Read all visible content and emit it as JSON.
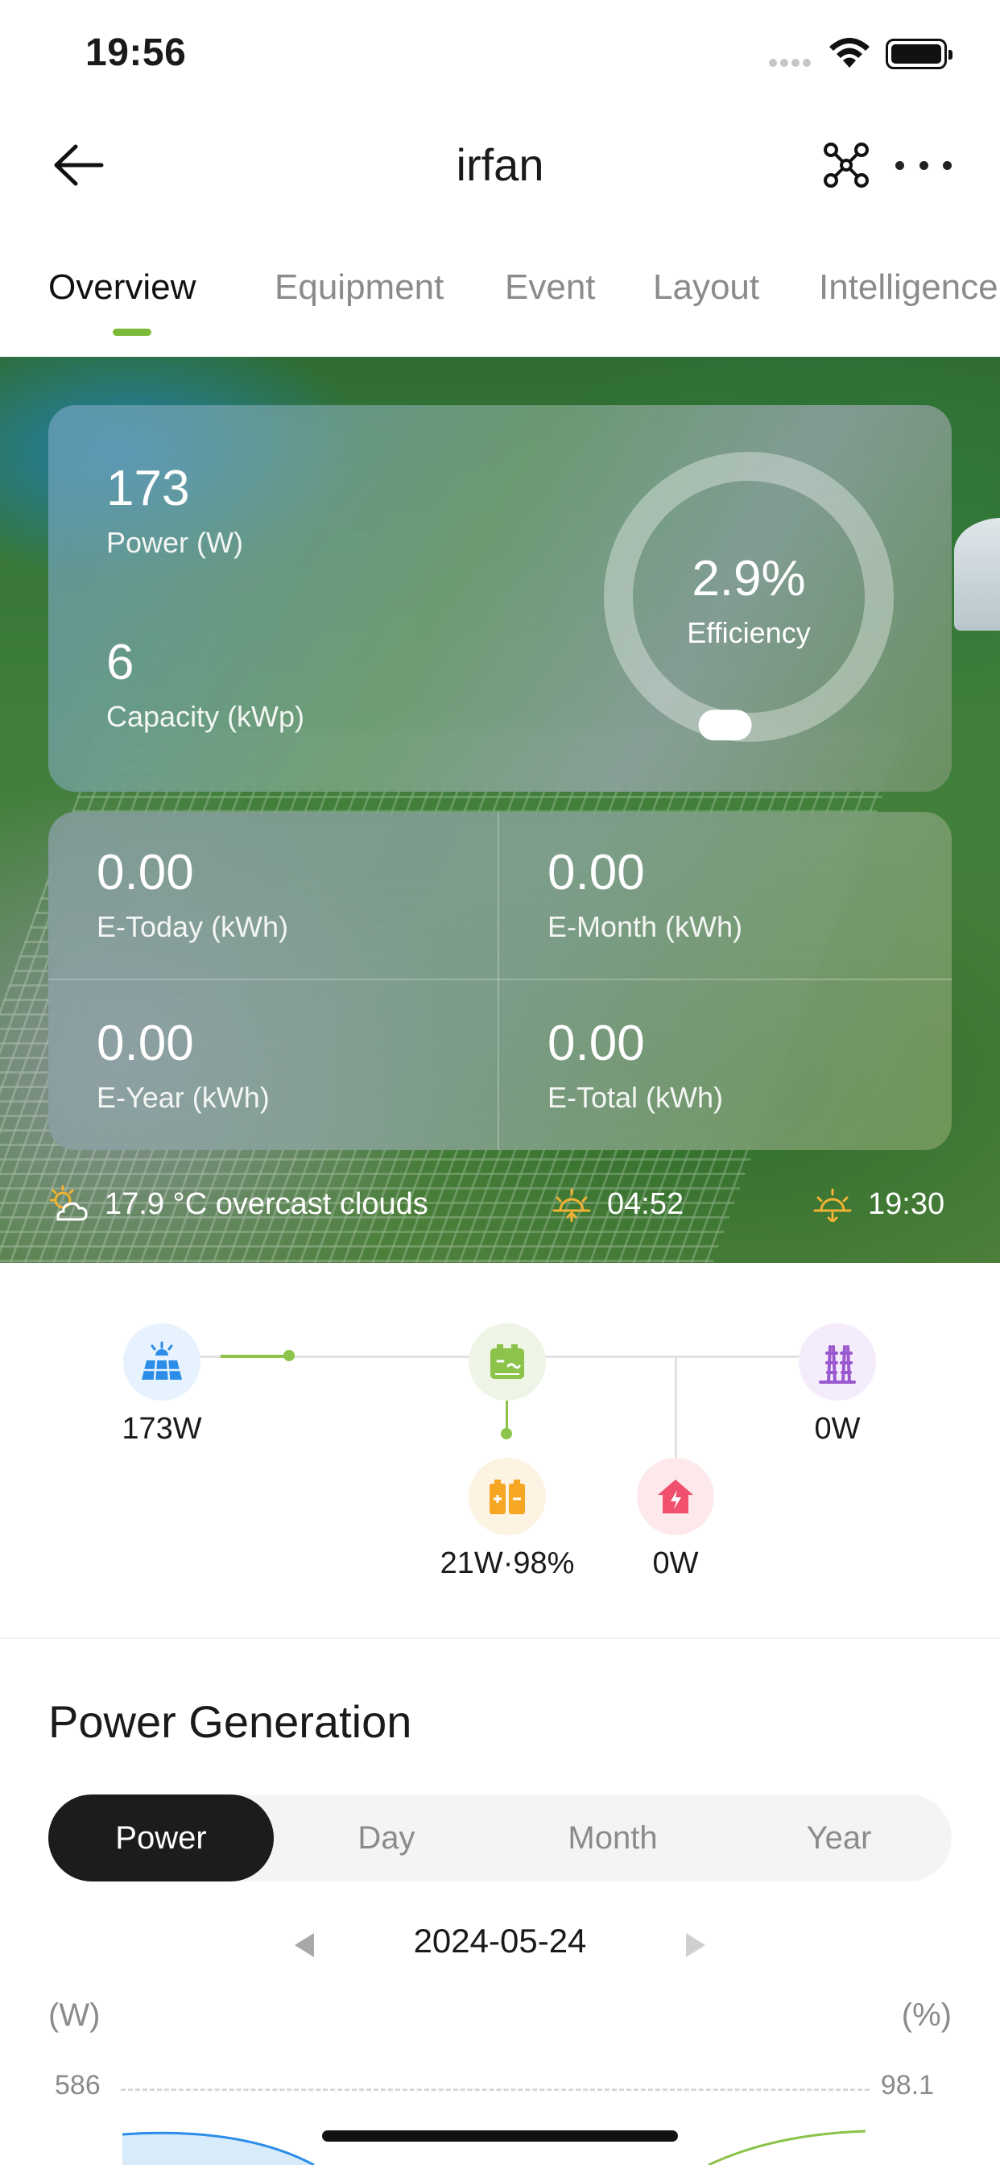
{
  "status_bar": {
    "time": "19:56"
  },
  "nav": {
    "title": "irfan"
  },
  "tabs": [
    "Overview",
    "Equipment",
    "Event",
    "Layout",
    "Intelligence"
  ],
  "summary": {
    "power_value": "173",
    "power_label": "Power (W)",
    "capacity_value": "6",
    "capacity_label": "Capacity (kWp)",
    "efficiency_value": "2.9%",
    "efficiency_label": "Efficiency",
    "efficiency_fraction": 0.029
  },
  "energy": {
    "today_value": "0.00",
    "today_label": "E-Today (kWh)",
    "month_value": "0.00",
    "month_label": "E-Month (kWh)",
    "year_value": "0.00",
    "year_label": "E-Year (kWh)",
    "total_value": "0.00",
    "total_label": "E-Total (kWh)"
  },
  "weather": {
    "conditions": "17.9 °C overcast clouds",
    "sunrise": "04:52",
    "sunset": "19:30"
  },
  "flow": {
    "solar": "173W",
    "grid": "0W",
    "battery": "21W·98%",
    "load": "0W"
  },
  "power_generation": {
    "title": "Power Generation",
    "tabs": [
      "Power",
      "Day",
      "Month",
      "Year"
    ],
    "active_tab": "Power",
    "date": "2024-05-24",
    "left_unit": "(W)",
    "right_unit": "(%)",
    "left_max": "586",
    "right_max": "98.1"
  },
  "colors": {
    "accent_green": "#7cbb3a",
    "solar_blue": "#2b8de8",
    "battery_orange": "#f5a623",
    "grid_purple": "#9b59d0",
    "load_red": "#f0506e"
  }
}
